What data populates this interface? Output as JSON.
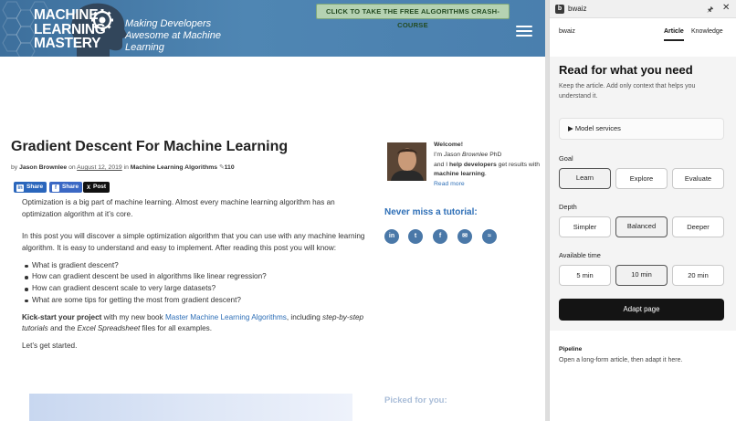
{
  "site": {
    "logo_lines": [
      "MACHINE",
      "LEARNING",
      "MASTERY"
    ],
    "tagline": "Making Developers Awesome at Machine Learning",
    "cta": "CLICK TO TAKE THE FREE ALGORITHMS CRASH-COURSE",
    "menu_icon": "hamburger-icon"
  },
  "article": {
    "title": "Gradient Descent For Machine Learning",
    "byline": {
      "by": "by",
      "author": "Jason Brownlee",
      "on": "on",
      "date": "August 12, 2019",
      "in": "in",
      "category": "Machine Learning Algorithms",
      "comments": "110"
    },
    "share": {
      "linkedin": "Share",
      "facebook": "Share",
      "x": "Post"
    },
    "para1": "Optimization is a big part of machine learning. Almost every machine learning algorithm has an optimization algorithm at it’s core.",
    "para2": "In this post you will discover a simple optimization algorithm that you can use with any machine learning algorithm. It is easy to understand and easy to implement. After reading this post you will know:",
    "bullets": [
      "What is gradient descent?",
      "How can gradient descent be used in algorithms like linear regression?",
      "How can gradient descent scale to very large datasets?",
      "What are some tips for getting the most from gradient descent?"
    ],
    "kickstart": {
      "bold": "Kick-start your project",
      "pre": " with my new book ",
      "link": "Master Machine Learning Algorithms",
      "mid": ", including ",
      "italic1": "step-by-step tutorials",
      "mid2": " and the ",
      "italic2": "Excel Spreadsheet",
      "post": " files for all examples."
    },
    "lets_start": "Let’s get started."
  },
  "sidebar": {
    "welcome": "Welcome!",
    "im": "I’m ",
    "name": "Jason Brownlee",
    "phd": " PhD",
    "and_i": "and I ",
    "help": "help developers",
    "get_results": " get results with ",
    "ml": "machine learning",
    "period": ".",
    "read_more": "Read more",
    "never_miss": "Never miss a tutorial:",
    "social": [
      "linkedin-icon",
      "twitter-icon",
      "facebook-icon",
      "email-icon",
      "rss-icon"
    ],
    "picked_for_you": "Picked for you:"
  },
  "panel": {
    "app_title": "bwaiz",
    "brand": "bwaiz",
    "tabs": [
      "Article",
      "Knowledge"
    ],
    "active_tab": "Article",
    "heading": "Read for what you need",
    "subheading": "Keep the article. Add only context that helps you understand it.",
    "model_services": "Model services",
    "goal": {
      "label": "Goal",
      "options": [
        "Learn",
        "Explore",
        "Evaluate"
      ],
      "selected": "Learn"
    },
    "depth": {
      "label": "Depth",
      "options": [
        "Simpler",
        "Balanced",
        "Deeper"
      ],
      "selected": "Balanced"
    },
    "time": {
      "label": "Available time",
      "options": [
        "5 min",
        "10 min",
        "20 min"
      ],
      "selected": "10 min"
    },
    "adapt_button": "Adapt page",
    "pipeline_label": "Pipeline",
    "pipeline_text": "Open a long-form article, then adapt it here."
  },
  "colors": {
    "header_blue": "#4a7fae",
    "link_blue": "#2e6fb7",
    "cta_green": "#b5d2b2",
    "adapt_black": "#141414"
  }
}
